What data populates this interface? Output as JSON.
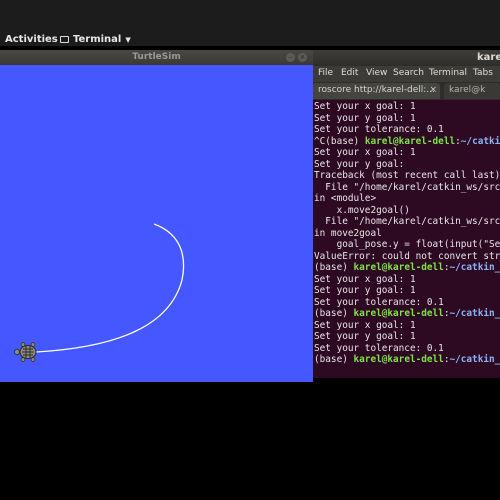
{
  "topbar": {
    "activities_label": "Activities",
    "app_label": "Terminal"
  },
  "turtlesim": {
    "title": "TurtleSim",
    "background_color": "#4557ff",
    "path_color": "#ffffff"
  },
  "terminal": {
    "title": "karel",
    "menu": [
      "File",
      "Edit",
      "View",
      "Search",
      "Terminal",
      "Tabs"
    ],
    "tabs": [
      {
        "label": "roscore http://karel-dell:..."
      },
      {
        "label": "karel@k"
      }
    ],
    "tab_close_glyph": "×",
    "lines": [
      {
        "text": "Set your x goal: 1"
      },
      {
        "text": "Set your y goal: 1"
      },
      {
        "text": "Set your tolerance: 0.1"
      },
      {
        "pre": "^C(base) ",
        "user": "karel@karel-dell",
        "sep": ":",
        "path": "~/catkin"
      },
      {
        "text": "Set your x goal: 1"
      },
      {
        "text": "Set your y goal:"
      },
      {
        "text": "Traceback (most recent call last)"
      },
      {
        "text": "  File \"/home/karel/catkin_ws/src"
      },
      {
        "text": "in <module>"
      },
      {
        "text": "    x.move2goal()"
      },
      {
        "text": "  File \"/home/karel/catkin_ws/src"
      },
      {
        "text": "in move2goal"
      },
      {
        "text": "    goal_pose.y = float(input(\"Se"
      },
      {
        "text": "ValueError: could not convert str"
      },
      {
        "pre": "(base) ",
        "user": "karel@karel-dell",
        "sep": ":",
        "path": "~/catkin_"
      },
      {
        "text": "Set your x goal: 1"
      },
      {
        "text": "Set your y goal: 1"
      },
      {
        "text": "Set your tolerance: 0.1"
      },
      {
        "pre": "(base) ",
        "user": "karel@karel-dell",
        "sep": ":",
        "path": "~/catkin_"
      },
      {
        "text": "Set your x goal: 1"
      },
      {
        "text": "Set your y goal: 1"
      },
      {
        "text": "Set your tolerance: 0.1"
      },
      {
        "pre": "(base) ",
        "user": "karel@karel-dell",
        "sep": ":",
        "path": "~/catkin_"
      }
    ]
  }
}
